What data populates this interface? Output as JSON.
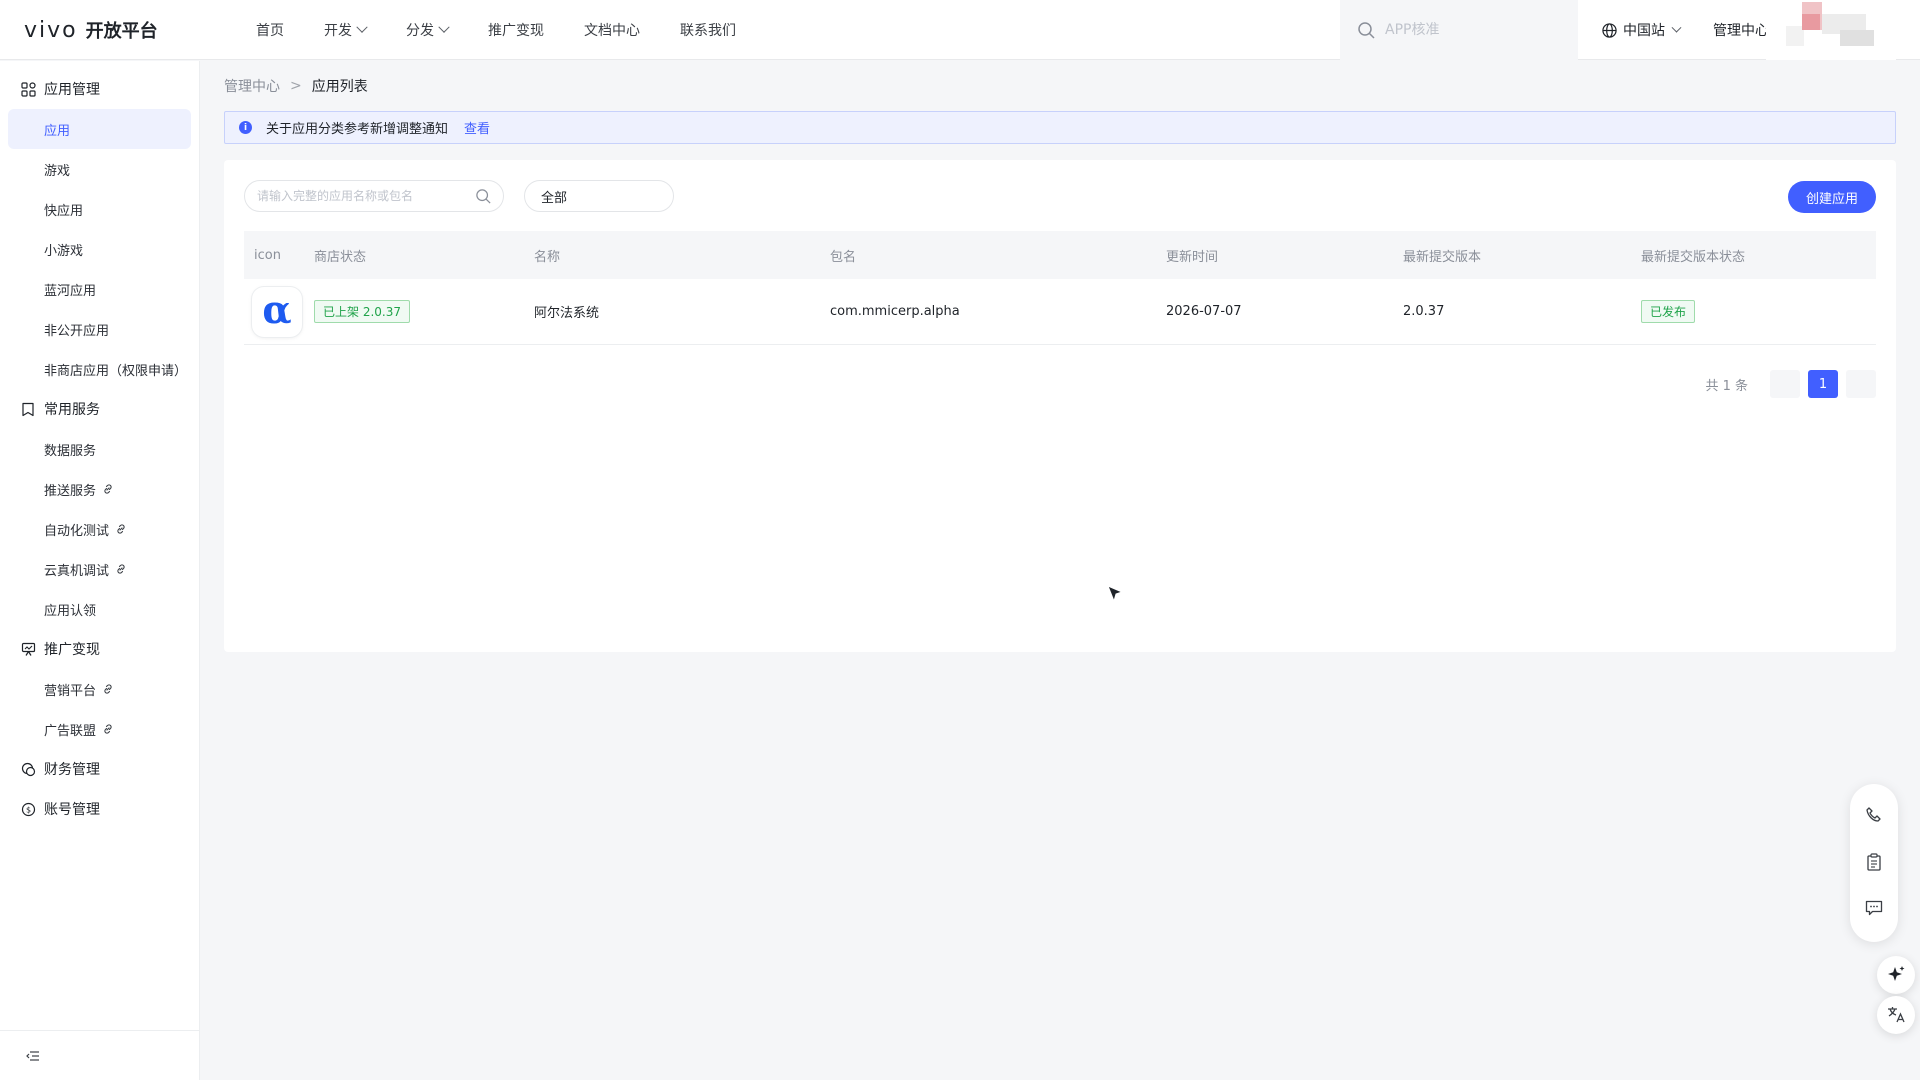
{
  "header": {
    "logo_brand": "vivo",
    "logo_text": "开放平台",
    "nav": [
      {
        "label": "首页",
        "has_dropdown": false
      },
      {
        "label": "开发",
        "has_dropdown": true
      },
      {
        "label": "分发",
        "has_dropdown": true
      },
      {
        "label": "推广变现",
        "has_dropdown": false
      },
      {
        "label": "文档中心",
        "has_dropdown": false
      },
      {
        "label": "联系我们",
        "has_dropdown": false
      }
    ],
    "search_placeholder": "APP核准",
    "region": "中国站",
    "admin_link": "管理中心"
  },
  "sidebar": {
    "groups": [
      {
        "label": "应用管理",
        "icon": "grid-icon",
        "items": [
          {
            "label": "应用",
            "active": true,
            "external": false
          },
          {
            "label": "游戏",
            "active": false,
            "external": false
          },
          {
            "label": "快应用",
            "active": false,
            "external": false
          },
          {
            "label": "小游戏",
            "active": false,
            "external": false
          },
          {
            "label": "蓝河应用",
            "active": false,
            "external": false
          },
          {
            "label": "非公开应用",
            "active": false,
            "external": false
          },
          {
            "label": "非商店应用（权限申请）",
            "active": false,
            "external": false
          }
        ]
      },
      {
        "label": "常用服务",
        "icon": "bookmark-icon",
        "items": [
          {
            "label": "数据服务",
            "active": false,
            "external": false
          },
          {
            "label": "推送服务",
            "active": false,
            "external": true
          },
          {
            "label": "自动化测试",
            "active": false,
            "external": true
          },
          {
            "label": "云真机调试",
            "active": false,
            "external": true
          },
          {
            "label": "应用认领",
            "active": false,
            "external": false
          }
        ]
      },
      {
        "label": "推广变现",
        "icon": "presentation-icon",
        "items": [
          {
            "label": "营销平台",
            "active": false,
            "external": true
          },
          {
            "label": "广告联盟",
            "active": false,
            "external": true
          }
        ]
      },
      {
        "label": "财务管理",
        "icon": "finance-icon",
        "items": []
      },
      {
        "label": "账号管理",
        "icon": "account-icon",
        "items": []
      }
    ]
  },
  "breadcrumb": {
    "parent": "管理中心",
    "separator": ">",
    "current": "应用列表"
  },
  "notice": {
    "text": "关于应用分类参考新增调整通知",
    "link": "查看"
  },
  "filters": {
    "search_placeholder": "请输入完整的应用名称或包名",
    "select_value": "全部",
    "create_button": "创建应用"
  },
  "table": {
    "headers": [
      "icon",
      "商店状态",
      "名称",
      "包名",
      "更新时间",
      "最新提交版本",
      "最新提交版本状态"
    ],
    "rows": [
      {
        "icon_glyph": "α",
        "store_status": "已上架 2.0.37",
        "name": "阿尔法系统",
        "package": "com.mmicerp.alpha",
        "updated": "2026-07-07",
        "version": "2.0.37",
        "version_status": "已发布"
      }
    ]
  },
  "pagination": {
    "total": "共 1 条",
    "current_page": "1"
  },
  "colors": {
    "accent": "#415fff",
    "success": "#20a34a",
    "notice_bg": "#eef1fe"
  }
}
